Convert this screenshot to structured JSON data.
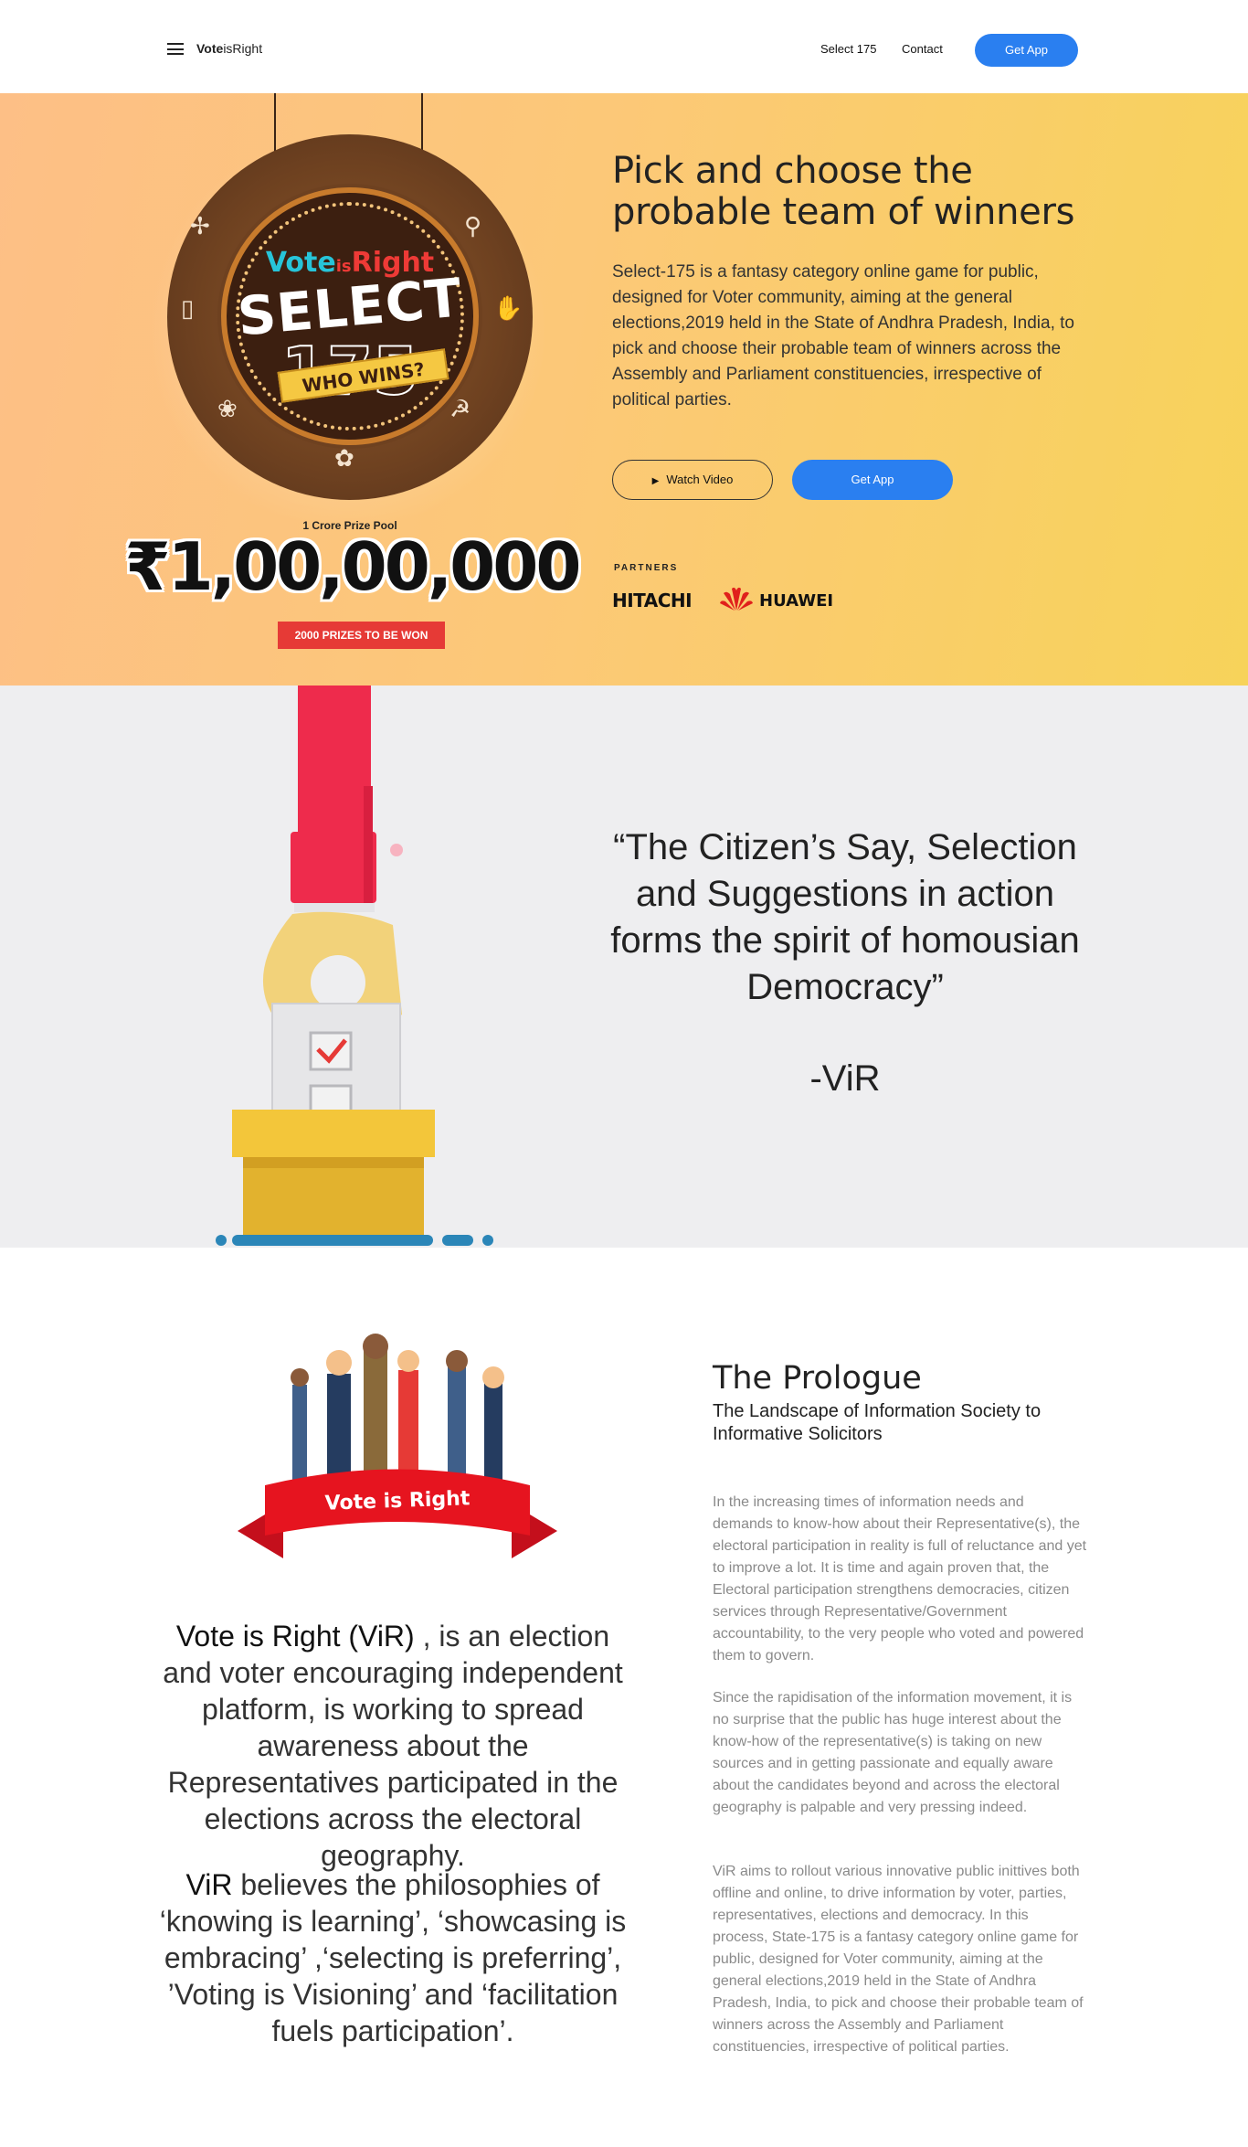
{
  "nav": {
    "brand_bold": "Vote",
    "brand_rest": "isRight",
    "links": [
      "Select 175",
      "Contact"
    ],
    "cta": "Get App"
  },
  "hero": {
    "medal": {
      "vote": "Vote",
      "is": "is",
      "right": "Right",
      "select": "SELECT",
      "number": "175",
      "tagline": "WHO WINS?"
    },
    "prize_pool_label": "1 Crore Prize Pool",
    "prize_amount": "₹1,00,00,000",
    "prize_badge": "2000 PRIZES TO BE WON",
    "title": "Pick and choose the probable team of winners",
    "description": "Select-175 is a fantasy category online game for public, designed for Voter community, aiming at the general elections,2019 held in the State of Andhra Pradesh, India, to pick and choose their probable team of winners across the Assembly and Parliament constituencies, irrespective of political parties.",
    "watch_video": "Watch Video",
    "get_app": "Get App",
    "partners_label": "PARTNERS",
    "partners": [
      "HITACHI",
      "HUAWEI"
    ]
  },
  "quote_section": {
    "quote": "“The Citizen’s Say, Selection and Suggestions in action forms the spirit of homousian Democracy”",
    "author": "-ViR"
  },
  "prologue": {
    "banner_text": "Vote is Right",
    "vir_intro_bold": "Vote is Right (ViR)",
    "vir_intro_rest": " , is an election and voter encouraging independent platform, is working to spread awareness about the Representatives participated in the elections across the electoral geography.",
    "vir_beliefs_bold": "ViR",
    "vir_beliefs_rest": " believes the philosophies of ‘knowing is learning’, ‘showcasing is embracing’ ,‘selecting is preferring’, ’Voting is Visioning’ and ‘facilitation fuels participation’.",
    "title": "The Prologue",
    "subtitle": "The Landscape of Information Society to Informative Solicitors",
    "paragraphs": [
      "In the increasing times of information needs and demands to know-how about their Representative(s), the electoral participation in reality is full of reluctance and yet to improve a lot. It is time and again proven that, the Electoral participation strengthens democracies, citizen services through Representative/Government accountability, to the very people who voted and powered them to govern.",
      "Since the rapidisation of the information movement, it is no surprise that the public has huge interest about the know-how of the representative(s) is taking on new sources and in getting passionate and equally aware about the candidates beyond and across the electoral geography is palpable and very pressing indeed.",
      "ViR aims to rollout various innovative public inittives both offline and online, to drive information by voter, parties, representatives, elections and democracy. In this process, State-175 is a fantasy category online game for public, designed for Voter community, aiming at the general elections,2019 held in the State of Andhra Pradesh, India, to pick and choose their probable team of winners across the Assembly and Parliament constituencies, irrespective of political parties."
    ]
  },
  "colors": {
    "accent_blue": "#2a7ff0",
    "prize_red": "#e63a36",
    "hero_gradient_start": "#fdbf86",
    "hero_gradient_end": "#f7d35a",
    "quote_bg": "#eeeef0"
  }
}
